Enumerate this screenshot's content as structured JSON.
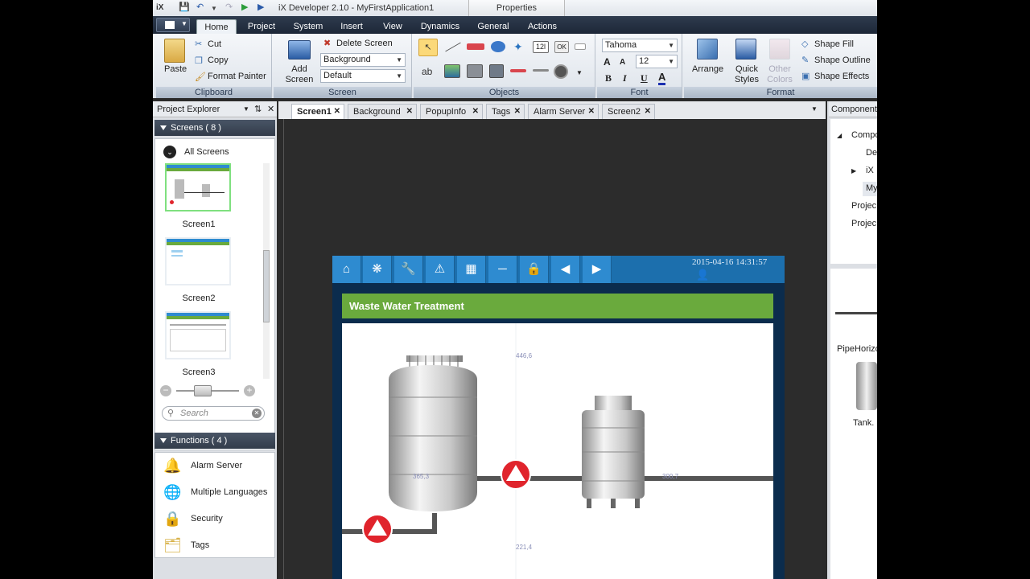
{
  "app": {
    "title": "iX Developer 2.10 - MyFirstApplication1",
    "context_tab": "Properties",
    "logo": "iX"
  },
  "ribbon_tabs": [
    "Home",
    "Project",
    "System",
    "Insert",
    "View",
    "Dynamics",
    "General",
    "Actions"
  ],
  "clipboard": {
    "paste": "Paste",
    "cut": "Cut",
    "copy": "Copy",
    "format_painter": "Format Painter",
    "label": "Clipboard"
  },
  "screen_group": {
    "add_screen": "Add Screen",
    "delete_screen": "Delete Screen",
    "background_value": "Background",
    "default_value": "Default",
    "label": "Screen"
  },
  "objects_group": {
    "label": "Objects",
    "ok_glyph": "OK",
    "num_glyph": "12l",
    "ab_glyph": "ab"
  },
  "font_group": {
    "font_name": "Tahoma",
    "font_size": "12",
    "bold": "B",
    "italic": "I",
    "underline": "U",
    "color_glyph": "A",
    "grow": "A",
    "shrink": "A",
    "label": "Font"
  },
  "format_group": {
    "arrange": "Arrange",
    "quick_styles": "Quick Styles",
    "other_colors": "Other Colors",
    "shape_fill": "Shape Fill",
    "shape_outline": "Shape Outline",
    "shape_effects": "Shape Effects",
    "label": "Format"
  },
  "project_explorer": {
    "title": "Project Explorer",
    "screens_header": "Screens ( 8 )",
    "all_screens": "All Screens",
    "screens": [
      "Screen1",
      "Screen2",
      "Screen3"
    ],
    "search_placeholder": "Search",
    "functions_header": "Functions ( 4 )",
    "functions": [
      "Alarm Server",
      "Multiple Languages",
      "Security",
      "Tags"
    ]
  },
  "doc_tabs": [
    "Screen1",
    "Background",
    "PopupInfo",
    "Tags",
    "Alarm Server",
    "Screen2"
  ],
  "hmi": {
    "datetime": "2015-04-16 14:31:57",
    "title": "Waste Water Treatment",
    "values": [
      "446,6",
      "365,3",
      "221,4",
      "300,7"
    ]
  },
  "components": {
    "title": "Components",
    "tree": [
      "Compo",
      "De",
      "iX",
      "My",
      "Projec",
      "Projec"
    ],
    "library_item": "PipeHorizo",
    "tank_item": "Tank."
  },
  "colors": {
    "accent_blue": "#2e8bd0",
    "title_green": "#6aaa3d",
    "alarm_red": "#e0242c"
  }
}
